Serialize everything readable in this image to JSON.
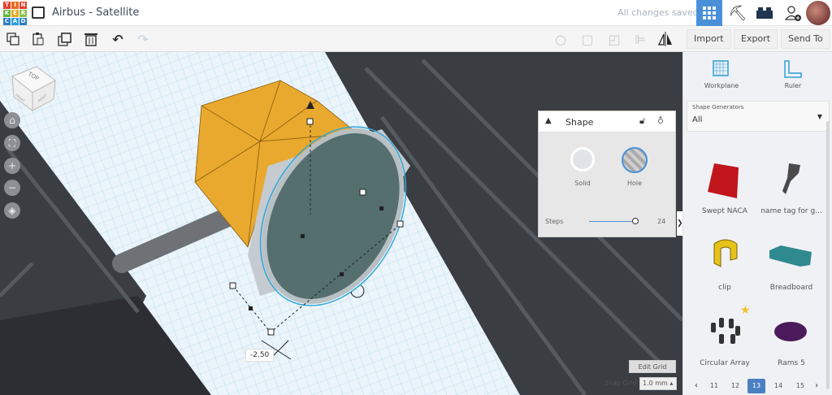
{
  "header": {
    "logo_letters": [
      "T",
      "I",
      "N",
      "K",
      "E",
      "R",
      "C",
      "A",
      "D"
    ],
    "title": "Airbus - Satellite",
    "status": "All changes saved"
  },
  "toolbar": {
    "import": "Import",
    "export": "Export",
    "send_to": "Send To"
  },
  "viewcube": {
    "top": "TOP",
    "front": "FRONT",
    "right": "RIGHT"
  },
  "viewport": {
    "dimension_value": "-2.50",
    "edit_grid": "Edit Grid",
    "snap_grid_label": "Snap Grid",
    "snap_grid_value": "1.0 mm"
  },
  "inspector": {
    "title": "Shape",
    "solid": "Solid",
    "hole": "Hole",
    "steps_label": "Steps",
    "steps_value": "24",
    "steps_fraction": 0.95
  },
  "panel": {
    "workplane": "Workplane",
    "ruler": "Ruler",
    "generators_label": "Shape Generators",
    "generators_value": "All",
    "shapes": [
      {
        "name": "Swept NACA"
      },
      {
        "name": "name tag for g..."
      },
      {
        "name": "clip"
      },
      {
        "name": "Breadboard"
      },
      {
        "name": "Circular Array"
      },
      {
        "name": "Rams 5"
      }
    ],
    "pages": [
      "11",
      "12",
      "13",
      "14",
      "15"
    ],
    "current_page": "13"
  },
  "colors": {
    "accent": "#4a90d9",
    "orange": "#e8a92e",
    "hole_teal": "#4f6b6b"
  }
}
